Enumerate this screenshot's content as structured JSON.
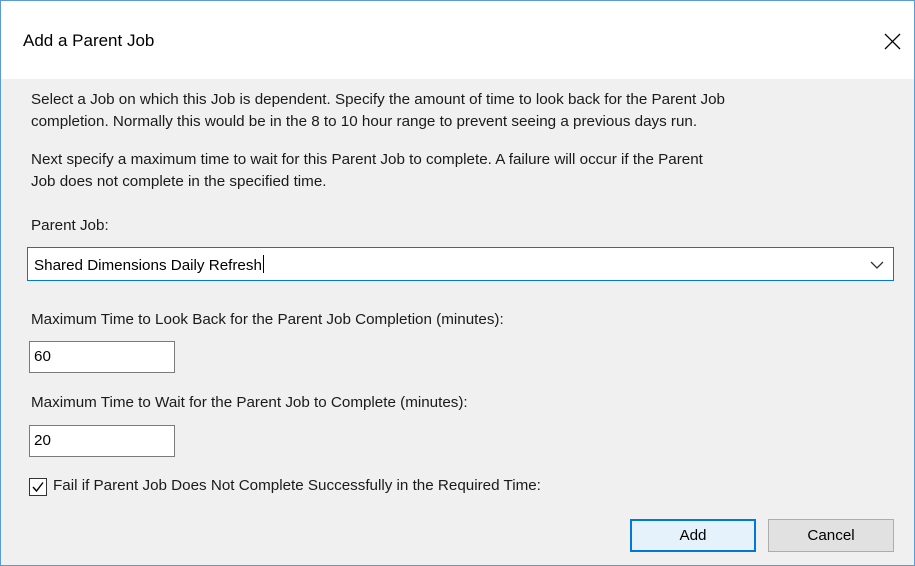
{
  "dialog": {
    "title": "Add a Parent Job",
    "close_icon": "close-icon"
  },
  "instructions": {
    "paragraph1_line1": "Select a Job on which this Job is dependent. Specify the amount of time to look back for the Parent Job",
    "paragraph1_line2": "completion. Normally this would be in the 8 to 10 hour range to prevent seeing a previous days run.",
    "paragraph2_line1": "Next specify a maximum time to wait for this Parent Job to complete. A failure will occur if the Parent",
    "paragraph2_line2": "Job does not complete in the specified time."
  },
  "parent_job": {
    "label": "Parent Job:",
    "selected_value": "Shared Dimensions Daily Refresh",
    "dropdown_icon": "chevron-down-icon"
  },
  "look_back": {
    "label": "Maximum Time to Look Back for the Parent Job Completion (minutes):",
    "value": "60"
  },
  "wait_time": {
    "label": "Maximum Time to Wait for the Parent Job to Complete (minutes):",
    "value": "20"
  },
  "fail_option": {
    "label": "Fail if Parent Job Does Not Complete Successfully in the Required Time:",
    "checked": true
  },
  "buttons": {
    "add_label": "Add",
    "cancel_label": "Cancel"
  }
}
